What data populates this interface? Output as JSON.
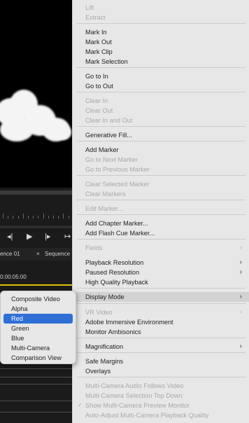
{
  "sequence_tabs": [
    "ence 01",
    "Sequence"
  ],
  "tab_close_glyph": "×",
  "timecode": "0:00:05:00",
  "transport_icons": [
    "step-back-icon",
    "play-icon",
    "step-forward-icon",
    "insert-icon"
  ],
  "context_menu": {
    "items": [
      {
        "label": "Lift",
        "enabled": false
      },
      {
        "label": "Extract",
        "enabled": false
      },
      {
        "label": "Mark In",
        "enabled": true
      },
      {
        "label": "Mark Out",
        "enabled": true
      },
      {
        "label": "Mark Clip",
        "enabled": true
      },
      {
        "label": "Mark Selection",
        "enabled": true
      },
      {
        "label": "Go to In",
        "enabled": true
      },
      {
        "label": "Go to Out",
        "enabled": true
      },
      {
        "label": "Clear In",
        "enabled": false
      },
      {
        "label": "Clear Out",
        "enabled": false
      },
      {
        "label": "Clear In and Out",
        "enabled": false
      },
      {
        "label": "Generative Fill...",
        "enabled": true
      },
      {
        "label": "Add Marker",
        "enabled": true
      },
      {
        "label": "Go to Next Marker",
        "enabled": false
      },
      {
        "label": "Go to Previous Marker",
        "enabled": false
      },
      {
        "label": "Clear Selected Marker",
        "enabled": false
      },
      {
        "label": "Clear Markers",
        "enabled": false
      },
      {
        "label": "Edit Marker...",
        "enabled": false
      },
      {
        "label": "Add Chapter Marker...",
        "enabled": true
      },
      {
        "label": "Add Flash Cue Marker...",
        "enabled": true
      },
      {
        "label": "Fields",
        "enabled": false,
        "submenu": true
      },
      {
        "label": "Playback Resolution",
        "enabled": true,
        "submenu": true
      },
      {
        "label": "Paused Resolution",
        "enabled": true,
        "submenu": true
      },
      {
        "label": "High Quality Playback",
        "enabled": true
      },
      {
        "label": "Display Mode",
        "enabled": true,
        "submenu": true,
        "highlighted": true
      },
      {
        "label": "VR Video",
        "enabled": false,
        "submenu": true
      },
      {
        "label": "Adobe Immersive Environment",
        "enabled": true
      },
      {
        "label": "Monitor Ambisonics",
        "enabled": true
      },
      {
        "label": "Magnification",
        "enabled": true,
        "submenu": true
      },
      {
        "label": "Safe Margins",
        "enabled": true
      },
      {
        "label": "Overlays",
        "enabled": true
      },
      {
        "label": "Multi-Camera Audio Follows Video",
        "enabled": false
      },
      {
        "label": "Multi-Camera Selection Top Down",
        "enabled": false
      },
      {
        "label": "Show Multi-Camera Preview Monitor",
        "enabled": false,
        "checked": true
      },
      {
        "label": "Auto-Adjust Multi-Camera Playback Quality",
        "enabled": false
      }
    ],
    "submenu_arrow": "›",
    "check_glyph": "✓"
  },
  "display_mode_submenu": {
    "items": [
      "Composite Video",
      "Alpha",
      "Red",
      "Green",
      "Blue",
      "Multi-Camera",
      "Comparison View"
    ],
    "selected": "Red",
    "selected_color": "#2f6fd6"
  }
}
